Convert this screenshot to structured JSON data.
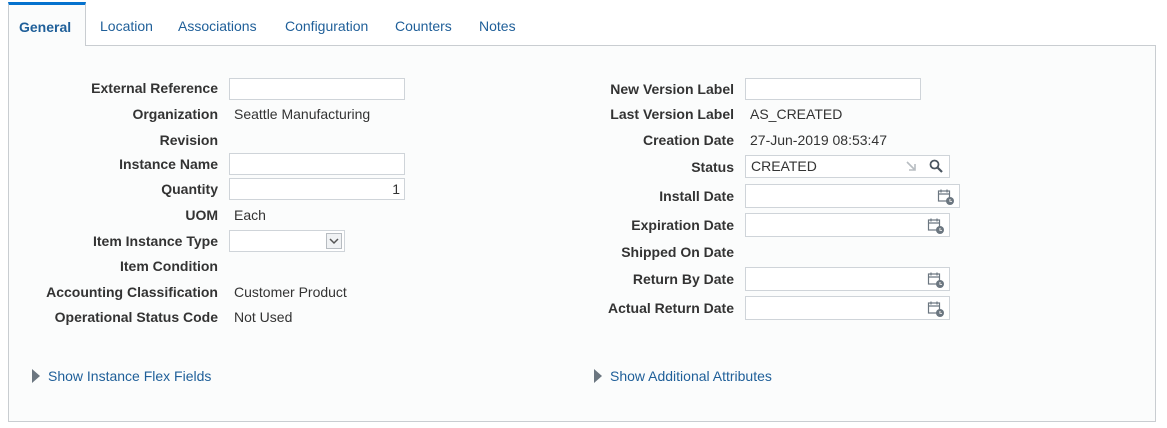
{
  "tabs": [
    {
      "label": "General"
    },
    {
      "label": "Location"
    },
    {
      "label": "Associations"
    },
    {
      "label": "Configuration"
    },
    {
      "label": "Counters"
    },
    {
      "label": "Notes"
    }
  ],
  "left_form": {
    "external_reference": {
      "label": "External Reference",
      "value": ""
    },
    "organization": {
      "label": "Organization",
      "value": "Seattle Manufacturing"
    },
    "revision": {
      "label": "Revision",
      "value": ""
    },
    "instance_name": {
      "label": "Instance Name",
      "value": ""
    },
    "quantity": {
      "label": "Quantity",
      "value": "1"
    },
    "uom": {
      "label": "UOM",
      "value": "Each"
    },
    "item_instance_type": {
      "label": "Item Instance Type",
      "value": ""
    },
    "item_condition": {
      "label": "Item Condition",
      "value": ""
    },
    "accounting_classification": {
      "label": "Accounting Classification",
      "value": "Customer Product"
    },
    "operational_status_code": {
      "label": "Operational Status Code",
      "value": "Not Used"
    }
  },
  "right_form": {
    "new_version_label": {
      "label": "New Version Label",
      "value": ""
    },
    "last_version_label": {
      "label": "Last Version Label",
      "value": "AS_CREATED"
    },
    "creation_date": {
      "label": "Creation Date",
      "value": "27-Jun-2019 08:53:47"
    },
    "status": {
      "label": "Status",
      "value": "CREATED"
    },
    "install_date": {
      "label": "Install Date",
      "value": ""
    },
    "expiration_date": {
      "label": "Expiration Date",
      "value": ""
    },
    "shipped_on_date": {
      "label": "Shipped On Date",
      "value": ""
    },
    "return_by_date": {
      "label": "Return By Date",
      "value": ""
    },
    "actual_return_date": {
      "label": "Actual Return Date",
      "value": ""
    }
  },
  "disclosures": {
    "instance_flex_fields": "Show Instance Flex Fields",
    "additional_attributes": "Show Additional Attributes"
  },
  "colors": {
    "link": "#1f5f99",
    "active_tab_border": "#0572ce"
  }
}
